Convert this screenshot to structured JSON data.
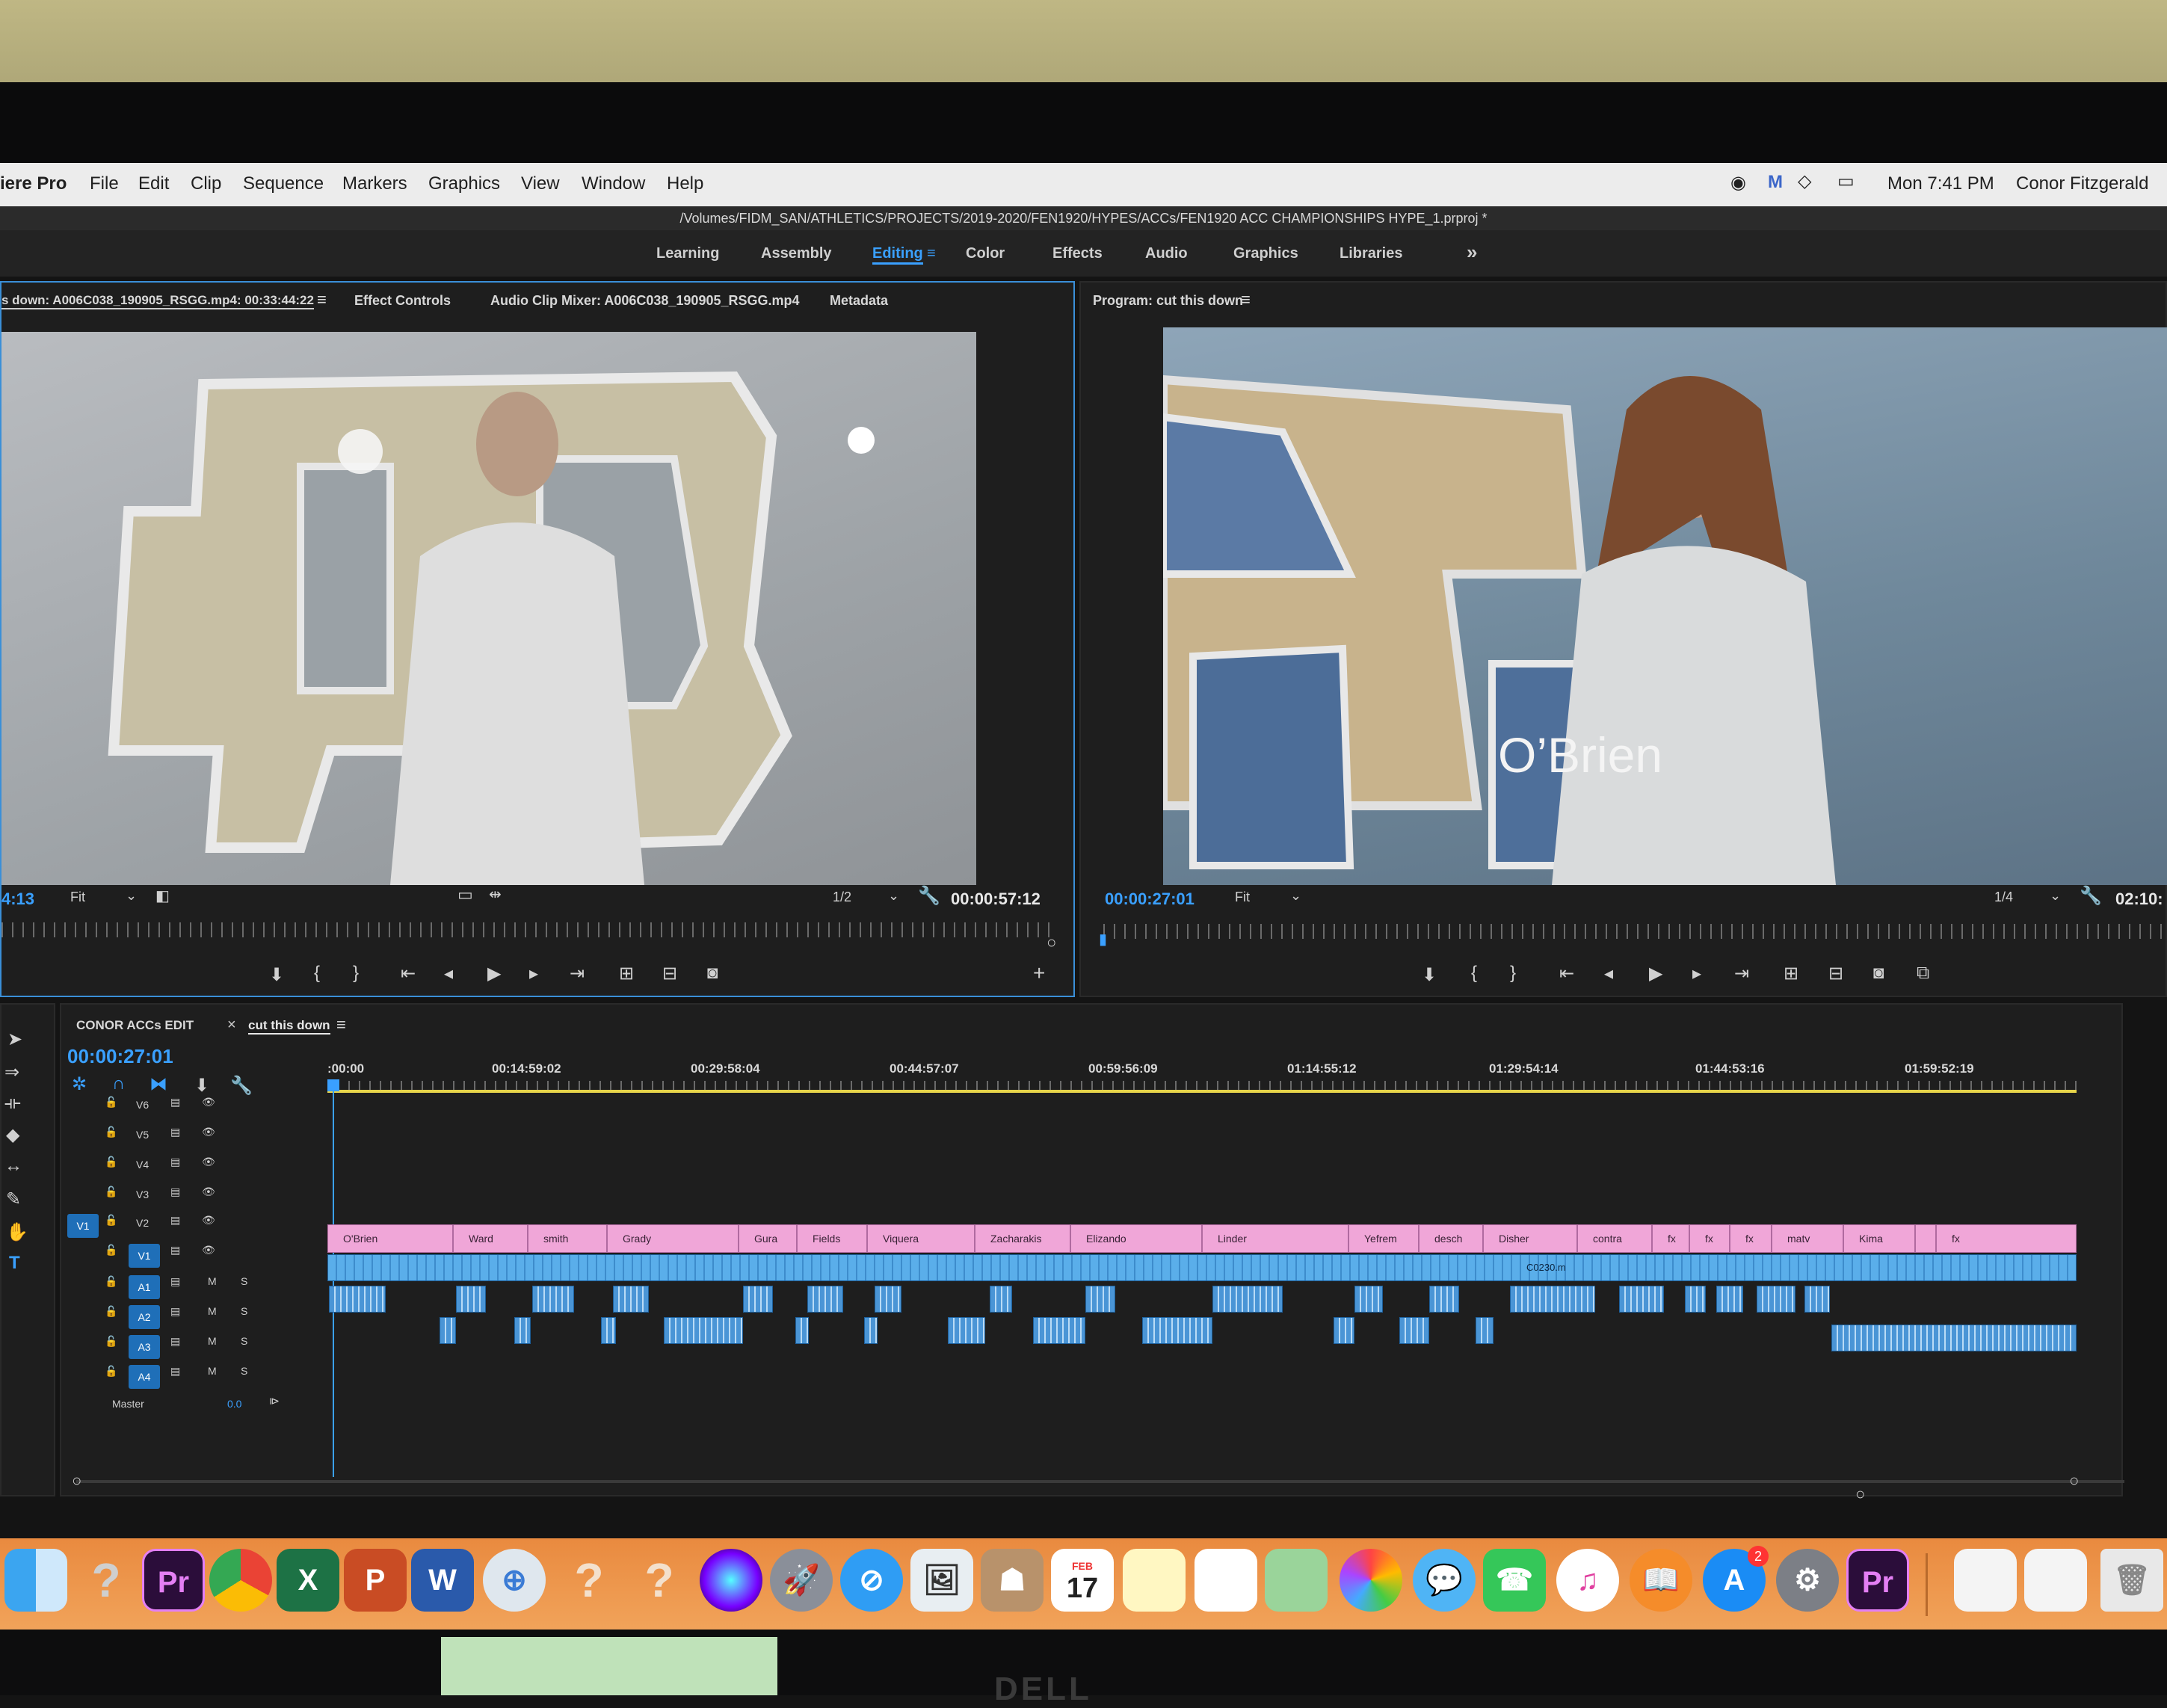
{
  "menubar": {
    "app_name": "iere Pro",
    "items": [
      "File",
      "Edit",
      "Clip",
      "Sequence",
      "Markers",
      "Graphics",
      "View",
      "Window",
      "Help"
    ],
    "clock": "Mon 7:41 PM",
    "user": "Conor Fitzgerald"
  },
  "project_path": "/Volumes/FIDM_SAN/ATHLETICS/PROJECTS/2019-2020/FEN1920/HYPES/ACCs/FEN1920 ACC CHAMPIONSHIPS HYPE_1.prproj *",
  "workspaces": [
    "Learning",
    "Assembly",
    "Editing",
    "Color",
    "Effects",
    "Audio",
    "Graphics",
    "Libraries"
  ],
  "workspace_active": "Editing",
  "workspace_more": "»",
  "source": {
    "tabs": [
      "s down: A006C038_190905_RSGG.mp4: 00:33:44:22",
      "Effect Controls",
      "Audio Clip Mixer: A006C038_190905_RSGG.mp4",
      "Metadata"
    ],
    "timecode_left": "4:13",
    "zoom": "Fit",
    "resolution": "1/2",
    "duration": "00:00:57:12"
  },
  "program": {
    "tab": "Program: cut this down",
    "timecode": "00:00:27:01",
    "zoom": "Fit",
    "resolution": "1/4",
    "duration": "02:10:",
    "overlay_title": "O’Brien"
  },
  "timeline": {
    "tabs": [
      "CONOR ACCs EDIT",
      "cut this down"
    ],
    "close_glyph": "×",
    "timecode": "00:00:27:01",
    "ruler": [
      ":00:00",
      "00:14:59:02",
      "00:29:58:04",
      "00:44:57:07",
      "00:59:56:09",
      "01:14:55:12",
      "01:29:54:14",
      "01:44:53:16",
      "01:59:52:19"
    ],
    "video_tracks": [
      "V6",
      "V5",
      "V4",
      "V3",
      "V2",
      "V1"
    ],
    "audio_tracks": [
      "A1",
      "A2",
      "A3",
      "A4"
    ],
    "source_patch": "V1",
    "master_label": "Master",
    "master_value": "0.0",
    "title_clips": [
      "O'Brien",
      "Ward",
      "smith",
      "Grady",
      "Gura",
      "Fields",
      "Viquera",
      "Zacharakis",
      "Elizando",
      "Linder",
      "Yefrem",
      "desch",
      "Disher",
      "contra",
      "matv",
      "Kima"
    ],
    "fx_label": "fx",
    "v1_clip_label": "C0230.m"
  },
  "dock": {
    "apps": [
      "Finder",
      "?",
      "Premiere Pro",
      "Chrome",
      "Excel",
      "PowerPoint",
      "Word",
      "Migration",
      "?",
      "?",
      "Siri",
      "Launchpad",
      "Safari",
      "Preview",
      "Contacts",
      "Calendar",
      "Notes",
      "Reminders",
      "Maps",
      "Photos",
      "Messages",
      "FaceTime",
      "iTunes",
      "Books",
      "App Store",
      "System Preferences",
      "Premiere Pro",
      "Downloads",
      "Documents",
      "Trash"
    ],
    "calendar_month": "FEB",
    "calendar_day": "17",
    "appstore_badge": "2"
  }
}
